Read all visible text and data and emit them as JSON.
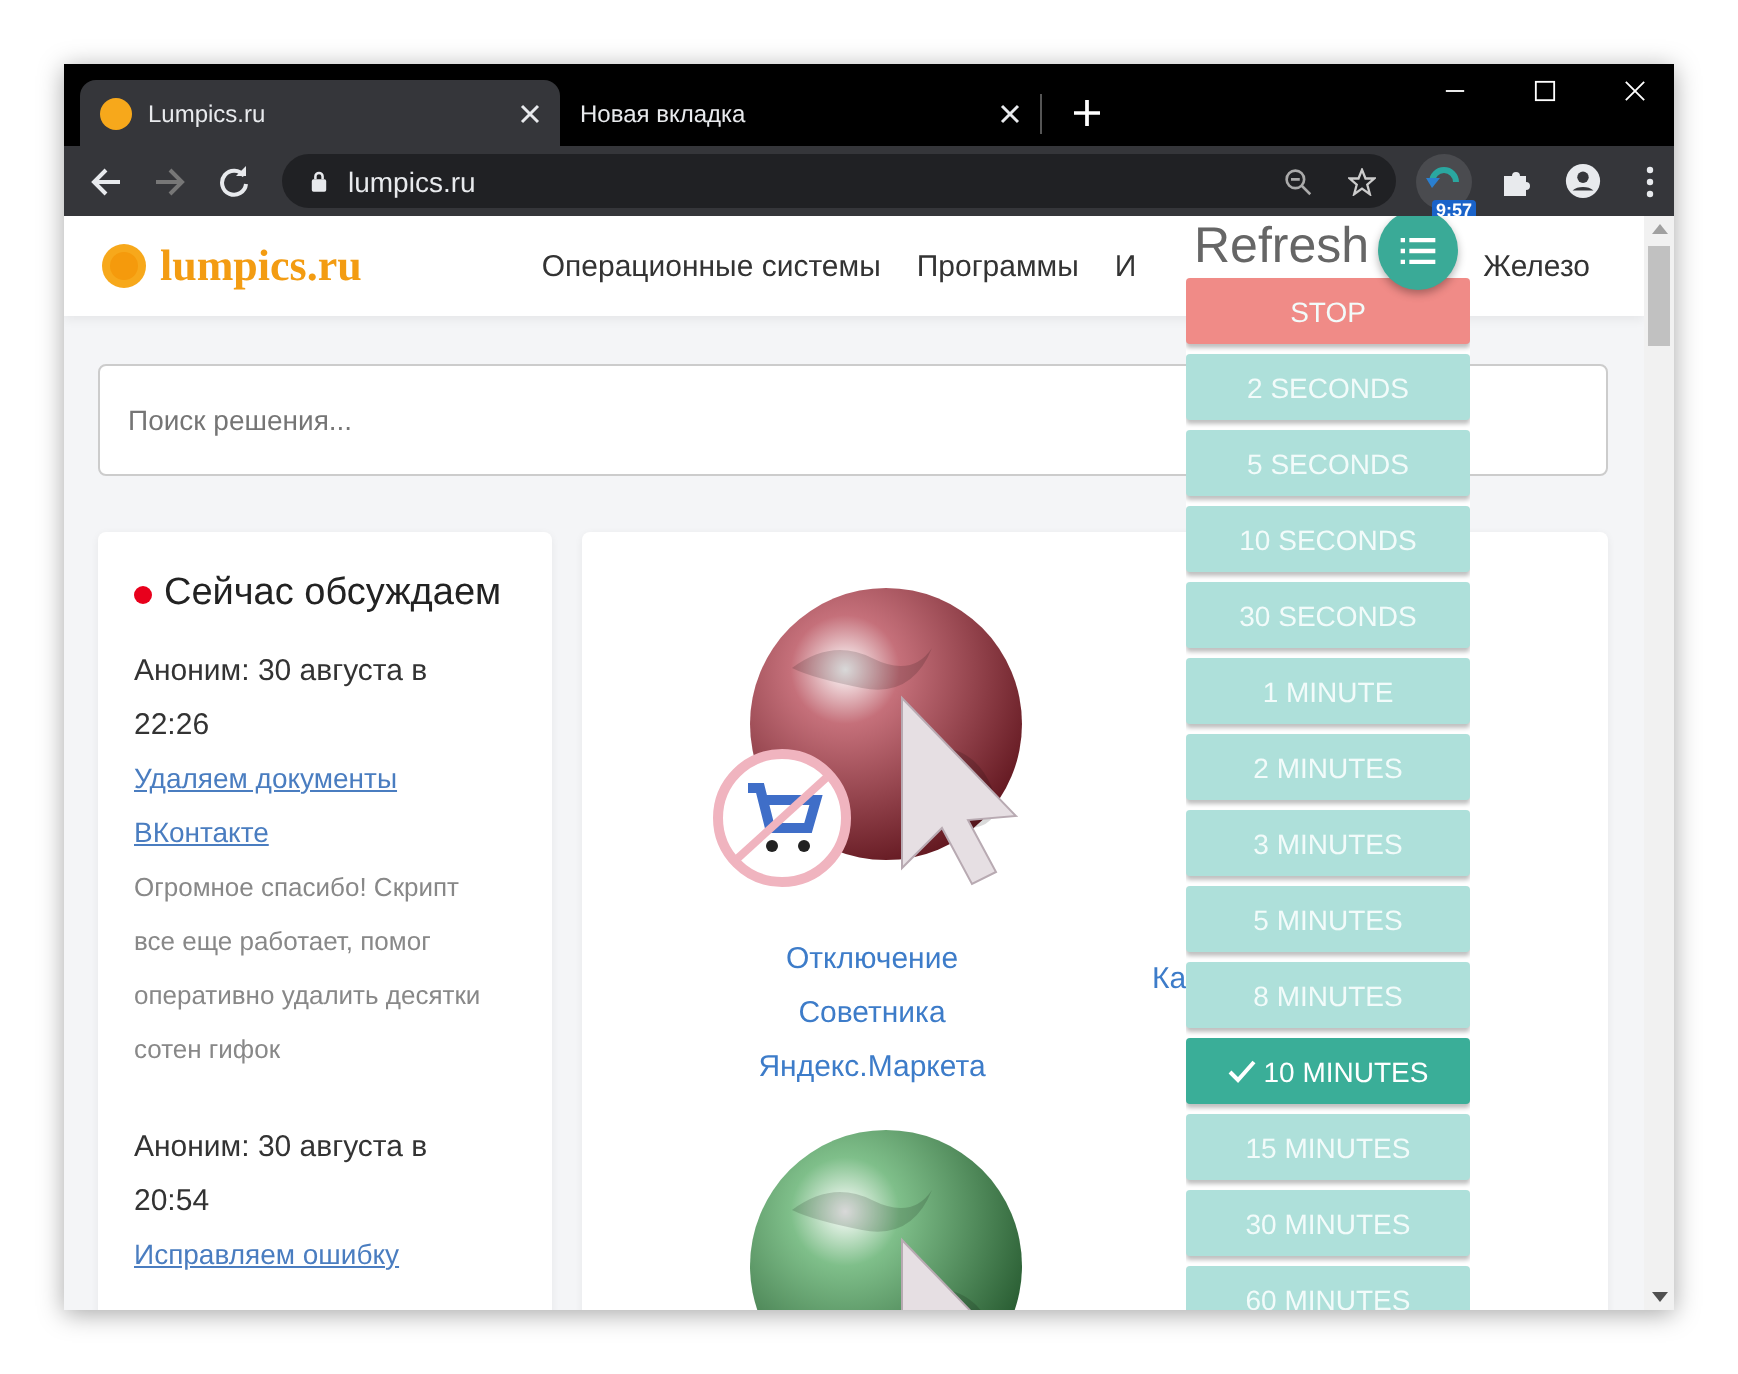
{
  "browser": {
    "tabs": [
      {
        "title": "Lumpics.ru",
        "selected": true
      },
      {
        "title": "Новая вкладка",
        "selected": false
      }
    ],
    "address": "lumpics.ru",
    "extension_badge": "9:57"
  },
  "site": {
    "logo": "lumpics.ru",
    "nav": [
      "Операционные системы",
      "Программы",
      "И",
      "Железо"
    ],
    "search": {
      "placeholder": "Поиск решения..."
    },
    "sidebar": {
      "title": "Сейчас обсуждаем",
      "comments": [
        {
          "author_time": "Аноним: 30 августа в 22:26",
          "link": "Удаляем документы ВКонтакте",
          "text": "Огромное спасибо! Скрипт все еще работает, помог оперативно удалить десятки сотен гифок"
        },
        {
          "author_time": "Аноним: 30 августа в 20:54",
          "link": "Исправляем ошибку"
        }
      ]
    },
    "articles": [
      {
        "title": "Отключение Советника Яндекс.Маркета",
        "kind": "red-globe"
      },
      {
        "title": "Ка",
        "kind": "hidden"
      },
      {
        "kind": "green-globe"
      }
    ]
  },
  "refresh_popup": {
    "title": "Refresh",
    "buttons": [
      {
        "label": "STOP",
        "kind": "stop",
        "selected": false
      },
      {
        "label": "2 SECONDS",
        "kind": "interval",
        "selected": false
      },
      {
        "label": "5 SECONDS",
        "kind": "interval",
        "selected": false
      },
      {
        "label": "10 SECONDS",
        "kind": "interval",
        "selected": false
      },
      {
        "label": "30 SECONDS",
        "kind": "interval",
        "selected": false
      },
      {
        "label": "1 MINUTE",
        "kind": "interval",
        "selected": false
      },
      {
        "label": "2 MINUTES",
        "kind": "interval",
        "selected": false
      },
      {
        "label": "3 MINUTES",
        "kind": "interval",
        "selected": false
      },
      {
        "label": "5 MINUTES",
        "kind": "interval",
        "selected": false
      },
      {
        "label": "8 MINUTES",
        "kind": "interval",
        "selected": false
      },
      {
        "label": "10 MINUTES",
        "kind": "interval",
        "selected": true
      },
      {
        "label": "15 MINUTES",
        "kind": "interval",
        "selected": false
      },
      {
        "label": "30 MINUTES",
        "kind": "interval",
        "selected": false
      },
      {
        "label": "60 MINUTES",
        "kind": "interval",
        "selected": false
      }
    ]
  }
}
